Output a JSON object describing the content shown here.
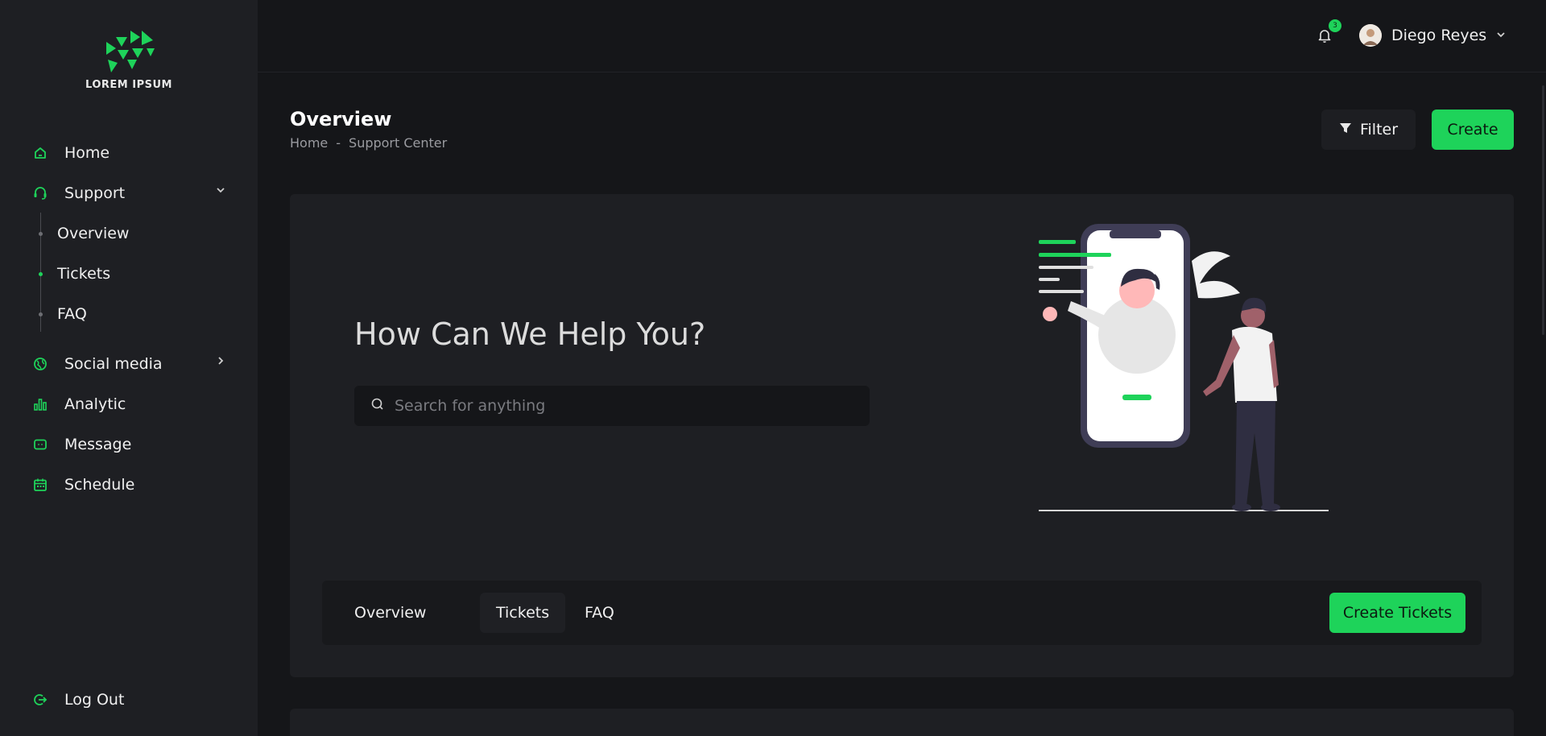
{
  "brand": {
    "name": "LOREM IPSUM"
  },
  "sidebar": {
    "items": [
      {
        "label": "Home",
        "icon": "home-icon"
      },
      {
        "label": "Support",
        "icon": "headset-icon"
      },
      {
        "label": "Social media",
        "icon": "globe-icon"
      },
      {
        "label": "Analytic",
        "icon": "bar-chart-icon"
      },
      {
        "label": "Message",
        "icon": "message-icon"
      },
      {
        "label": "Schedule",
        "icon": "calendar-icon"
      }
    ],
    "support_sub": [
      {
        "label": "Overview",
        "active": false
      },
      {
        "label": "Tickets",
        "active": true
      },
      {
        "label": "FAQ",
        "active": false
      }
    ],
    "logout": "Log Out"
  },
  "topbar": {
    "notifications": "3",
    "user_name": "Diego Reyes"
  },
  "header": {
    "title": "Overview",
    "breadcrumb": [
      "Home",
      "-",
      "Support Center"
    ],
    "filter_label": "Filter",
    "create_label": "Create"
  },
  "hero": {
    "title": "How Can We Help You?",
    "search_placeholder": "Search for anything"
  },
  "tabs": {
    "items": [
      "Overview",
      "Tickets",
      "FAQ"
    ],
    "active": "Tickets",
    "create_tickets_label": "Create Tickets"
  },
  "colors": {
    "accent": "#1ed35a",
    "sidebar_bg": "#1e1f23",
    "page_bg": "#151619"
  }
}
